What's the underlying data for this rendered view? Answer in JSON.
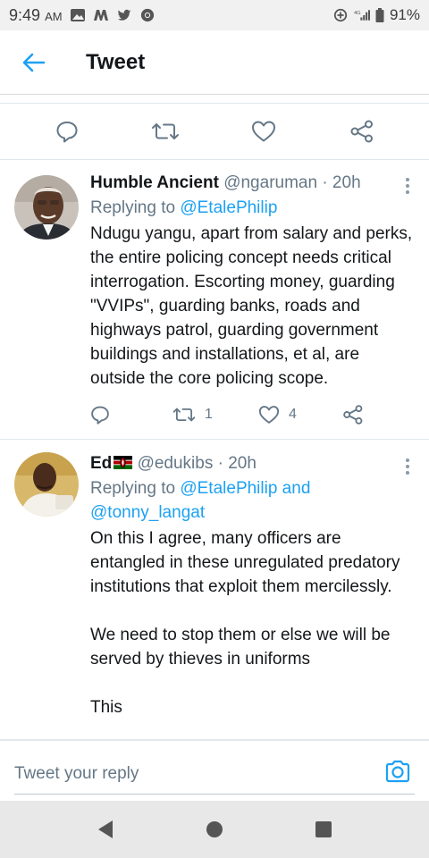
{
  "status_bar": {
    "time": "9:49",
    "ampm": "AM",
    "battery": "91%",
    "network": "4G"
  },
  "header": {
    "title": "Tweet"
  },
  "colors": {
    "accent": "#1da1f2",
    "secondary_text": "#657786",
    "primary_text": "#14171a"
  },
  "main_actions": [
    {
      "icon": "reply-icon"
    },
    {
      "icon": "retweet-icon"
    },
    {
      "icon": "like-icon"
    },
    {
      "icon": "share-icon"
    }
  ],
  "replies": [
    {
      "display_name": "Humble Ancient",
      "handle": "@ngaruman",
      "time": "· 20h",
      "replying_prefix": "Replying to ",
      "replying_mentions": "@EtalePhilip",
      "text": "Ndugu yangu, apart from salary and perks, the entire policing concept needs critical interrogation. Escorting money, guarding \"VVIPs\", guarding banks, roads and highways patrol, guarding government buildings and installations, et al, are outside the core policing scope.",
      "retweet_count": "1",
      "like_count": "4"
    },
    {
      "display_name": "Ed",
      "flag": "kenya-flag-icon",
      "handle": "@edukibs",
      "time": "· 20h",
      "replying_prefix": "Replying to ",
      "replying_mentions": "@EtalePhilip and @tonny_langat",
      "text": "On this I agree, many officers are entangled in these unregulated predatory institutions that exploit them mercilessly.\n\nWe need to stop them or else we will be served by thieves in uniforms\n\nThis"
    }
  ],
  "compose": {
    "placeholder": "Tweet your reply"
  }
}
